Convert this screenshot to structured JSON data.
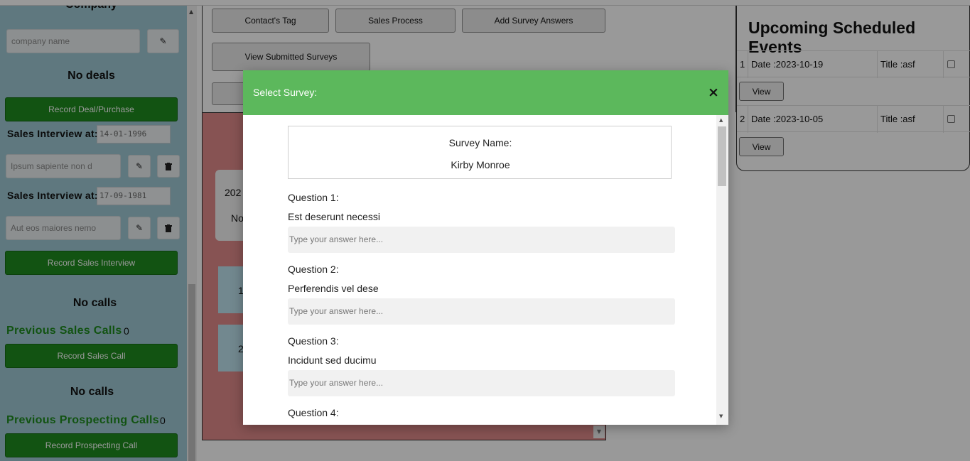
{
  "sidebar": {
    "company_heading": "Company",
    "company_placeholder": "company name",
    "no_deals": "No deals",
    "record_deal_label": "Record Deal/Purchase",
    "interviews": [
      {
        "label": "Sales Interview at:",
        "date": "14-01-1996",
        "note": "Ipsum sapiente non d"
      },
      {
        "label": "Sales Interview at:",
        "date": "17-09-1981",
        "note": "Aut eos maiores nemo"
      }
    ],
    "record_interview_label": "Record Sales Interview",
    "no_calls_1": "No calls",
    "previous_sales_calls_label": "Previous Sales Calls",
    "previous_sales_calls_count": "0",
    "record_sales_call_label": "Record Sales Call",
    "no_calls_2": "No calls",
    "previous_prospecting_calls_label": "Previous Prospecting Calls",
    "previous_prospecting_calls_count": "0",
    "record_prospecting_call_label": "Record Prospecting Call"
  },
  "toolbar": {
    "contacts_tag": "Contact's Tag",
    "sales_process": "Sales Process",
    "add_survey_answers": "Add Survey Answers",
    "view_submitted_surveys": "View Submitted Surveys"
  },
  "background_panel": {
    "card_line1": "202",
    "card_line2": "No",
    "rows": [
      "1",
      "2"
    ]
  },
  "events": {
    "heading": "Upcoming Scheduled Events",
    "items": [
      {
        "index": "1",
        "date": "Date :2023-10-19",
        "title": "Title :asf",
        "view": "View"
      },
      {
        "index": "2",
        "date": "Date :2023-10-05",
        "title": "Title :asf",
        "view": "View"
      }
    ]
  },
  "modal": {
    "title": "Select Survey:",
    "close_glyph": "×",
    "survey_name_label": "Survey Name:",
    "survey_name": "Kirby Monroe",
    "answer_placeholder": "Type your answer here...",
    "questions": [
      {
        "label": "Question 1:",
        "text": "Est deserunt necessi"
      },
      {
        "label": "Question 2:",
        "text": "Perferendis vel dese"
      },
      {
        "label": "Question 3:",
        "text": "Incidunt sed ducimu"
      },
      {
        "label": "Question 4:",
        "text": ""
      }
    ]
  },
  "icons": {
    "edit": "pencil-icon",
    "delete": "trash-icon",
    "close": "close-icon"
  },
  "colors": {
    "modal_header": "#5cb85c",
    "green_button": "#1e8a1e",
    "sidebar_bg": "#9ec9d4",
    "red_panel": "#e18a8a"
  }
}
